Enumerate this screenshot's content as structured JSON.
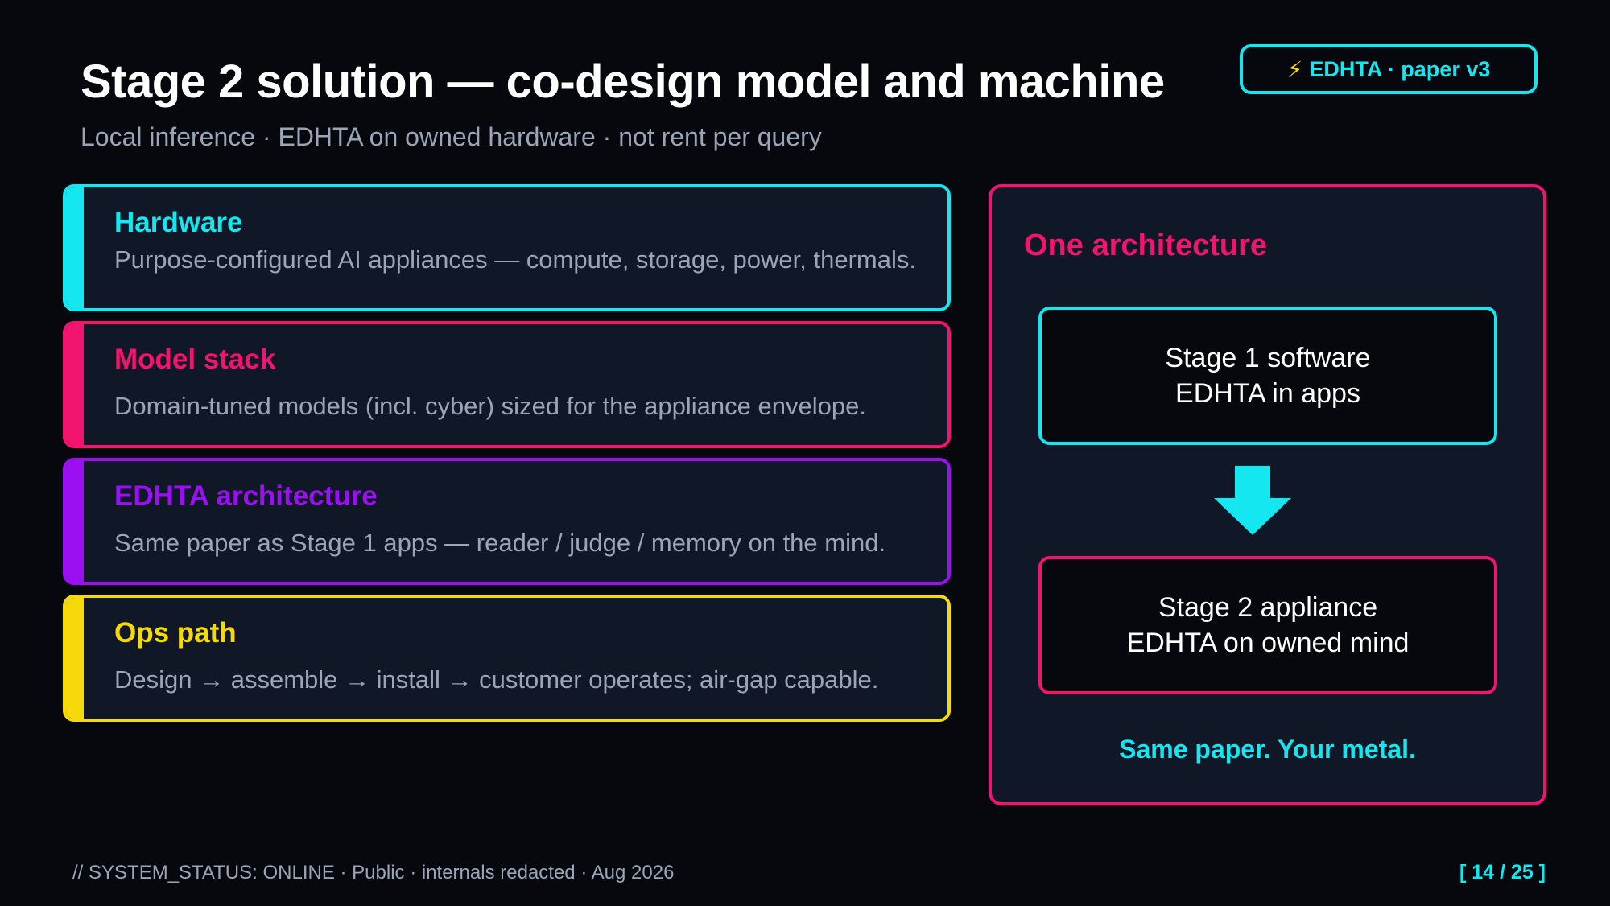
{
  "header": {
    "title": "Stage 2 solution — co-design model and machine",
    "subtitle": "Local inference · EDHTA on owned hardware · not rent per query",
    "badge": {
      "icon": "lightning-icon",
      "icon_glyph": "⚡",
      "label": "EDHTA · paper v3"
    }
  },
  "cards": [
    {
      "title": "Hardware",
      "description": "Purpose-configured AI appliances — compute, storage, power, thermals.",
      "color": "#14e7f0"
    },
    {
      "title": "Model stack",
      "description": "Domain-tuned models (incl. cyber) sized for the appliance envelope.",
      "color": "#f2146f"
    },
    {
      "title": "EDHTA architecture",
      "description": "Same paper as Stage 1 apps — reader / judge / memory on the mind.",
      "color": "#9b10f2"
    },
    {
      "title": "Ops path",
      "description": "Design → assemble → install → customer operates; air-gap capable.",
      "color": "#f5d90a"
    }
  ],
  "panel": {
    "title": "One architecture",
    "stage1": {
      "line1": "Stage 1 software",
      "line2": "EDHTA in apps"
    },
    "stage2": {
      "line1": "Stage 2 appliance",
      "line2": "EDHTA on owned mind"
    },
    "tagline": "Same paper. Your metal."
  },
  "footer": {
    "status": "// SYSTEM_STATUS: ONLINE  ·  Public · internals redacted · Aug 2026",
    "page": "[ 14 / 25 ]"
  },
  "colors": {
    "cyan": "#14e7f0",
    "pink": "#f2146f",
    "purple": "#9b10f2",
    "yellow": "#f5d90a",
    "background": "#06080d"
  }
}
